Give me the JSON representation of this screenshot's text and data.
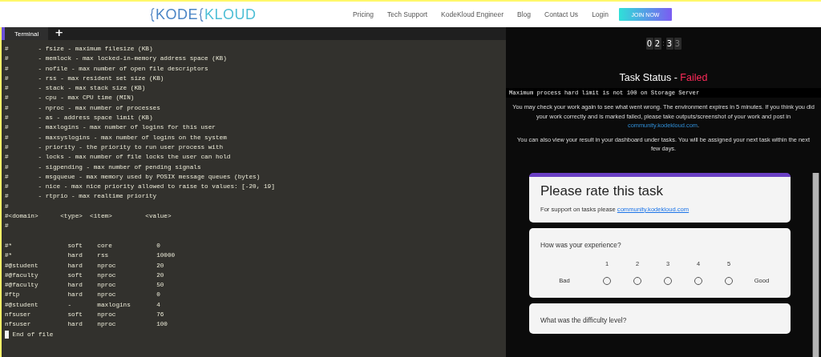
{
  "nav": {
    "logo": [
      "KODE",
      "KLOUD"
    ],
    "links": [
      "Pricing",
      "Tech Support",
      "KodeKloud Engineer",
      "Blog",
      "Contact Us",
      "Login"
    ],
    "cta": "JOIN NOW"
  },
  "terminal": {
    "tabs": [
      {
        "label": "Terminal",
        "selected": true
      }
    ],
    "add_tab": "+",
    "lines": [
      "#        - fsize - maximum filesize (KB)",
      "#        - memlock - max locked-in-memory address space (KB)",
      "#        - nofile - max number of open file descriptors",
      "#        - rss - max resident set size (KB)",
      "#        - stack - max stack size (KB)",
      "#        - cpu - max CPU time (MIN)",
      "#        - nproc - max number of processes",
      "#        - as - address space limit (KB)",
      "#        - maxlogins - max number of logins for this user",
      "#        - maxsyslogins - max number of logins on the system",
      "#        - priority - the priority to run user process with",
      "#        - locks - max number of file locks the user can hold",
      "#        - sigpending - max number of pending signals",
      "#        - msgqueue - max memory used by POSIX message queues (bytes)",
      "#        - nice - max nice priority allowed to raise to values: [-20, 19]",
      "#        - rtprio - max realtime priority",
      "#",
      "#<domain>      <type>  <item>         <value>",
      "#"
    ],
    "entries": [
      "#*               soft    core            0",
      "#*               hard    rss             10000",
      "#@student        hard    nproc           20",
      "#@faculty        soft    nproc           20",
      "#@faculty        hard    nproc           50",
      "#ftp             hard    nproc           0",
      "#@student        -       maxlogins       4",
      "nfsuser          soft    nproc           76",
      "nfsuser          hard    nproc           100"
    ],
    "cursor_line": {
      "text": " End of file",
      "cursor": true
    }
  },
  "status": {
    "timer": [
      "0",
      "2",
      ":",
      "3",
      "3"
    ],
    "title": "Task Status - ",
    "result": "Failed",
    "message": "Maximum process hard limit is not 100 on Storage Server",
    "paragraphs": [
      "You may check your work again to see what went wrong. The environment expires in 5 minutes. If you think you did your work correctly and is marked failed, please take outputs/screenshot of your work and post in ",
      "You can also view your result in your dashboard under tasks. You will be assigned your next task within the next few days."
    ],
    "community_link": "community.kodekloud.com",
    "link_end": "."
  },
  "form": {
    "title": "Please rate this task",
    "support_text": "For support on tasks please ",
    "support_link": "community.kodekloud.com",
    "questions": [
      {
        "text": "How was your experience?",
        "low": "Bad",
        "high": "Good",
        "options": [
          {
            "label": "1",
            "selected": false
          },
          {
            "label": "2",
            "selected": false
          },
          {
            "label": "3",
            "selected": false
          },
          {
            "label": "4",
            "selected": false
          },
          {
            "label": "5",
            "selected": false
          }
        ]
      },
      {
        "text": "What was the difficulty level?"
      }
    ]
  }
}
